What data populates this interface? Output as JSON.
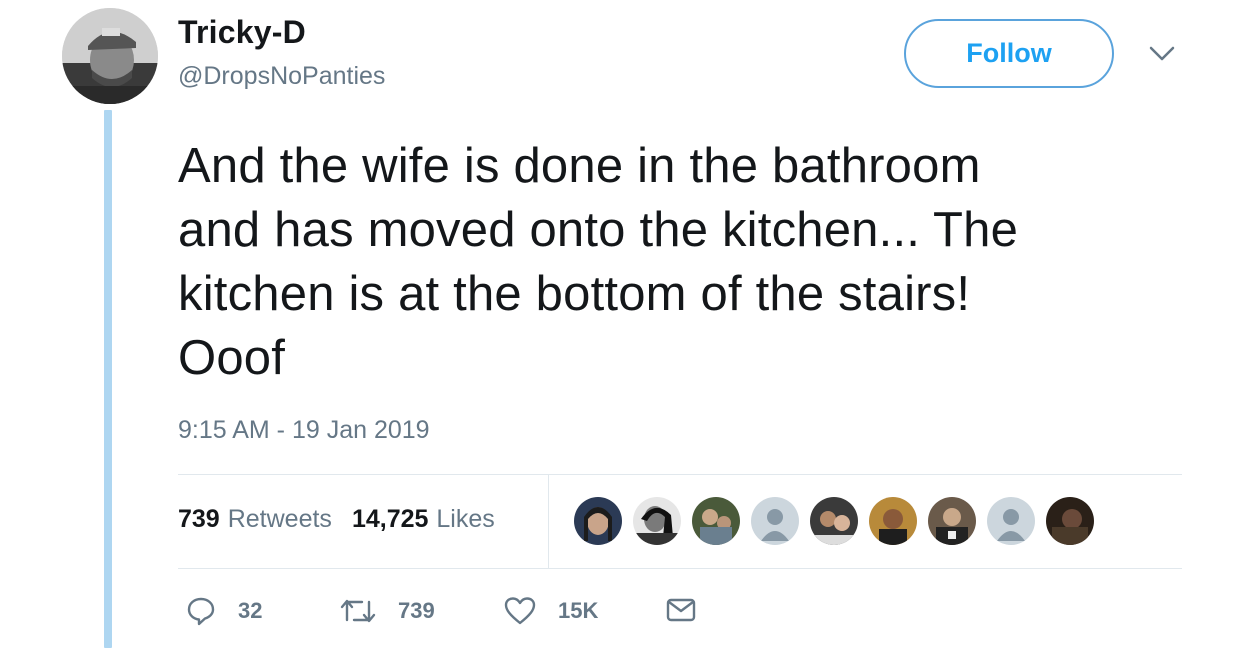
{
  "user": {
    "display_name": "Tricky-D",
    "handle": "@DropsNoPanties"
  },
  "follow_label": "Follow",
  "tweet": {
    "text_lines": [
      "And the wife is done in the bathroom",
      "and has moved onto the kitchen... The",
      "kitchen is at the bottom of the stairs!",
      "Ooof"
    ],
    "timestamp": "9:15 AM - 19 Jan 2019"
  },
  "stats": {
    "retweets_count": "739",
    "retweets_label": "Retweets",
    "likes_count": "14,725",
    "likes_label": "Likes"
  },
  "likers": [
    {
      "icon": "photo-avatar"
    },
    {
      "icon": "photo-avatar"
    },
    {
      "icon": "photo-avatar"
    },
    {
      "icon": "default-user-avatar"
    },
    {
      "icon": "photo-avatar"
    },
    {
      "icon": "photo-avatar"
    },
    {
      "icon": "photo-avatar"
    },
    {
      "icon": "default-user-avatar"
    },
    {
      "icon": "photo-avatar"
    }
  ],
  "actions": {
    "reply_count": "32",
    "retweet_count": "739",
    "like_count": "15K"
  },
  "colors": {
    "accent": "#1da1f2",
    "muted": "#657786",
    "thread_line": "#aed6f1"
  }
}
